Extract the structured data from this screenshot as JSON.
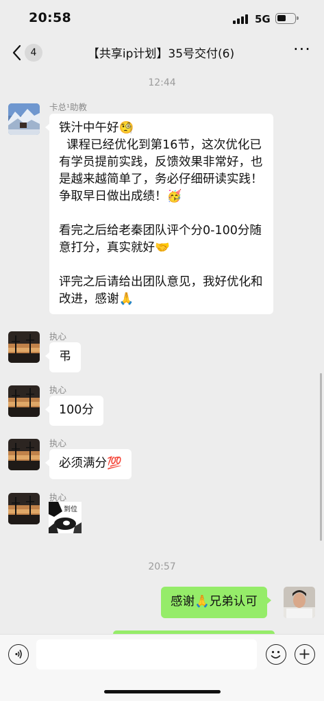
{
  "status": {
    "time": "20:58",
    "network": "5G"
  },
  "nav": {
    "unread_count": "4",
    "title": "【共享ip计划】35号交付(6)"
  },
  "timestamps": {
    "first": "12:44",
    "second": "20:57"
  },
  "messages": [
    {
      "sender": "卡总¹助教",
      "paragraphs": [
        "铁汁中午好🧐",
        "  课程已经优化到第16节，这次优化已有学员提前实践，反馈效果非常好，也是越来越简单了，务必仔细研读实践！争取早日做出成绩！🥳",
        "看完之后给老秦团队评个分0-100分随意打分，真实就好🤝",
        "评完之后请给出团队意见，我好优化和改进，感谢🙏"
      ]
    },
    {
      "sender": "执心",
      "text": "弔"
    },
    {
      "sender": "执心",
      "text": "100分"
    },
    {
      "sender": "执心",
      "text": "必须满分💯"
    },
    {
      "sender": "执心",
      "sticker_text": "到位"
    },
    {
      "sender": "me",
      "text": "感谢🙏兄弟认可"
    }
  ],
  "colors": {
    "background": "#ededed",
    "my_bubble": "#95ec69",
    "their_bubble": "#ffffff"
  },
  "icons": {
    "back": "chevron-left-icon",
    "more": "more-icon",
    "voice": "voice-icon",
    "emoji": "emoji-icon",
    "add": "plus-icon"
  }
}
